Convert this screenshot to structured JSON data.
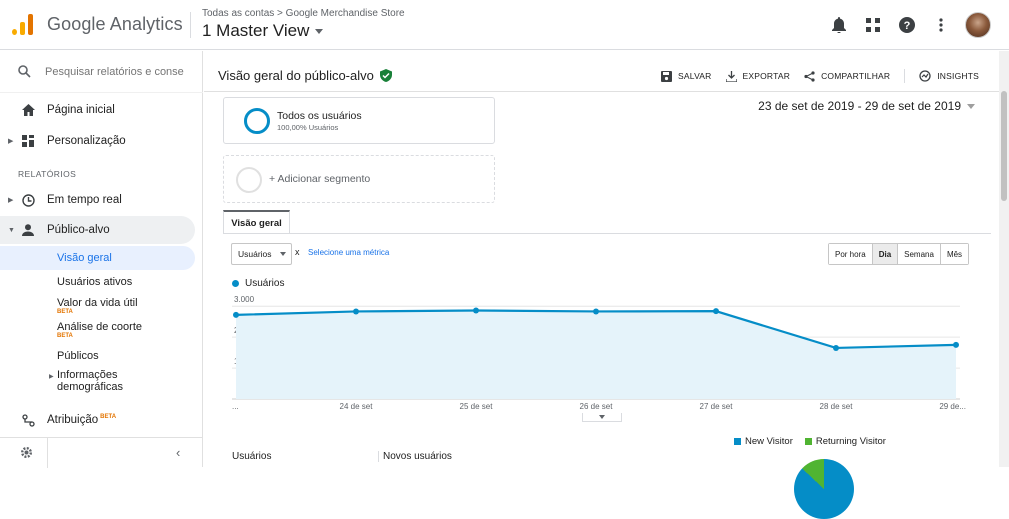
{
  "header": {
    "app_name": "Google Analytics",
    "breadcrumb": "Todas as contas > Google Merchandise Store",
    "view_name": "1 Master View"
  },
  "sidebar": {
    "search_placeholder": "Pesquisar relatórios e conse",
    "home": "Página inicial",
    "customization": "Personalização",
    "reports_section": "RELATÓRIOS",
    "realtime": "Em tempo real",
    "audience": "Público-alvo",
    "audience_items": [
      {
        "label": "Visão geral"
      },
      {
        "label": "Usuários ativos"
      },
      {
        "label": "Valor da vida útil",
        "badge": "BETA"
      },
      {
        "label": "Análise de coorte",
        "badge": "BETA"
      },
      {
        "label": "Públicos"
      },
      {
        "label": "Informações demográficas"
      }
    ],
    "attribution": "Atribuição",
    "attribution_badge": "BETA"
  },
  "main": {
    "title": "Visão geral do público-alvo",
    "actions": {
      "save": "SALVAR",
      "export": "EXPORTAR",
      "share": "COMPARTILHAR",
      "insights": "INSIGHTS"
    },
    "segment": {
      "name": "Todos os usuários",
      "subtitle": "100,00% Usuários"
    },
    "add_segment": "+ Adicionar segmento",
    "date_range": "23 de set de 2019 - 29 de set de 2019",
    "tab": "Visão geral",
    "metric_select": "Usuários",
    "metric_x": "x",
    "select_metric": "Selecione uma métrica",
    "granularity": [
      "Por hora",
      "Dia",
      "Semana",
      "Mês"
    ],
    "granularity_active": "Dia",
    "legend": "Usuários",
    "series_color": "#058dc7",
    "metrics_headers": [
      "Usuários",
      "Novos usuários"
    ],
    "pie_legend": [
      {
        "label": "New Visitor",
        "color": "#058dc7"
      },
      {
        "label": "Returning Visitor",
        "color": "#50b432"
      }
    ]
  },
  "chart_data": {
    "type": "area",
    "x": [
      "...",
      "24 de set",
      "25 de set",
      "26 de set",
      "27 de set",
      "28 de set",
      "29 de..."
    ],
    "series": [
      {
        "name": "Usuários",
        "values": [
          2720,
          2830,
          2860,
          2830,
          2840,
          1650,
          1750
        ]
      }
    ],
    "yticks": [
      "3.000",
      "2.000",
      "1.000"
    ],
    "ylim": [
      0,
      3200
    ],
    "grid": true
  }
}
